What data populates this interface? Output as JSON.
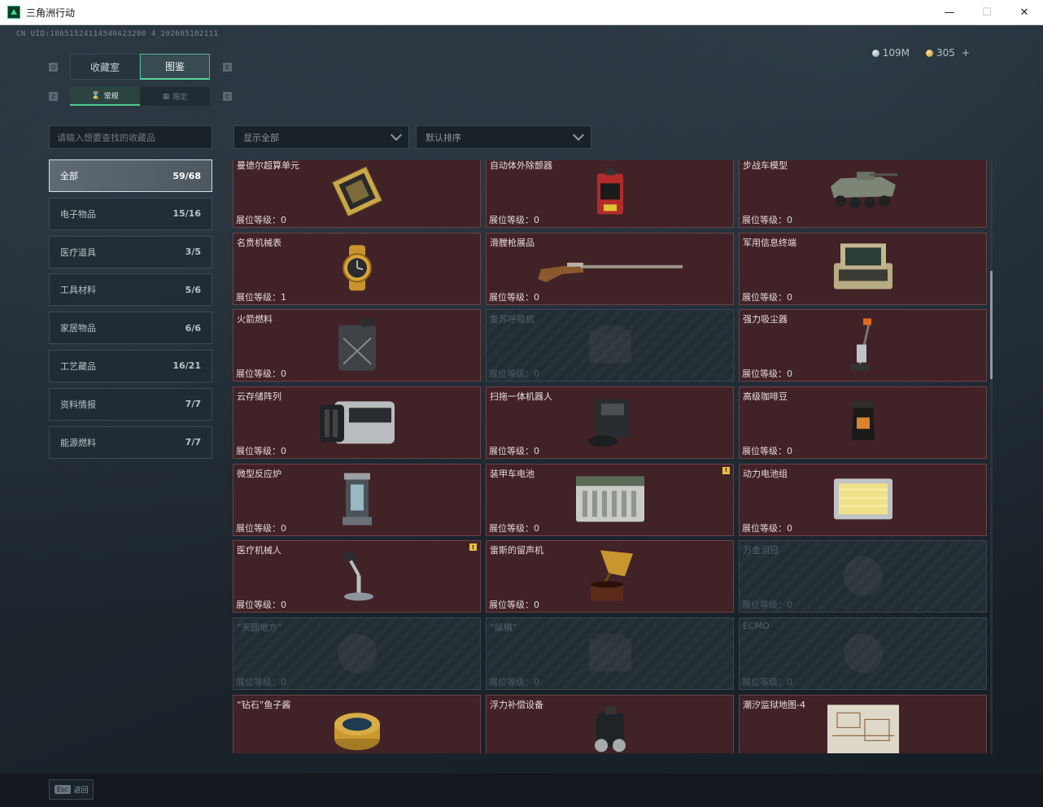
{
  "window": {
    "title": "三角洲行动",
    "minimize": "—",
    "maximize": "☐",
    "close": "✕"
  },
  "uid_text": "CN UID:18651524114540423200 4_202605102111",
  "currency": {
    "silver": "109M",
    "gold": "305",
    "plus": "+"
  },
  "main_tabs": [
    {
      "label": "收藏室"
    },
    {
      "label": "图鉴"
    }
  ],
  "sub_tabs": [
    {
      "label": "常规",
      "icon": "hourglass-icon"
    },
    {
      "label": "限定",
      "icon": "film-icon"
    }
  ],
  "key_hints": {
    "left": "Q",
    "right": "E",
    "sub_left": "Z",
    "sub_right": "C"
  },
  "search": {
    "placeholder": "请输入想要查找的收藏品"
  },
  "filters": {
    "show": "显示全部",
    "sort": "默认排序"
  },
  "categories": [
    {
      "label": "全部",
      "count": "59/68"
    },
    {
      "label": "电子物品",
      "count": "15/16"
    },
    {
      "label": "医疗道具",
      "count": "3/5"
    },
    {
      "label": "工具材料",
      "count": "5/6"
    },
    {
      "label": "家居物品",
      "count": "6/6"
    },
    {
      "label": "工艺藏品",
      "count": "16/21"
    },
    {
      "label": "资料情报",
      "count": "7/7"
    },
    {
      "label": "能源燃料",
      "count": "7/7"
    }
  ],
  "level_label": "展位等级：",
  "items": [
    {
      "name": "曼德尔超算单元",
      "level": "0",
      "locked": false,
      "art": "chip"
    },
    {
      "name": "自动体外除颤器",
      "level": "0",
      "locked": false,
      "art": "defib"
    },
    {
      "name": "步战车模型",
      "level": "0",
      "locked": false,
      "art": "ifv"
    },
    {
      "name": "名贵机械表",
      "level": "1",
      "locked": false,
      "art": "watch"
    },
    {
      "name": "滑膛枪展品",
      "level": "0",
      "locked": false,
      "art": "musket"
    },
    {
      "name": "军用信息终端",
      "level": "0",
      "locked": false,
      "art": "terminal"
    },
    {
      "name": "火箭燃料",
      "level": "0",
      "locked": false,
      "art": "jerrycan"
    },
    {
      "name": "复苏呼吸机",
      "level": "0",
      "locked": true,
      "art": "box"
    },
    {
      "name": "强力吸尘器",
      "level": "0",
      "locked": false,
      "art": "vacuum"
    },
    {
      "name": "云存储阵列",
      "level": "0",
      "locked": false,
      "art": "server"
    },
    {
      "name": "扫拖一体机器人",
      "level": "0",
      "locked": false,
      "art": "robot"
    },
    {
      "name": "高级咖啡豆",
      "level": "0",
      "locked": false,
      "art": "coffee"
    },
    {
      "name": "微型反应炉",
      "level": "0",
      "locked": false,
      "art": "reactor"
    },
    {
      "name": "装甲车电池",
      "level": "0",
      "locked": false,
      "art": "battery",
      "badge": "!"
    },
    {
      "name": "动力电池组",
      "level": "0",
      "locked": false,
      "art": "powercell"
    },
    {
      "name": "医疗机械人",
      "level": "0",
      "locked": false,
      "art": "medbot",
      "badge": "!"
    },
    {
      "name": "雷斯的留声机",
      "level": "0",
      "locked": false,
      "art": "gramophone"
    },
    {
      "name": "万金泪冠",
      "level": "0",
      "locked": true,
      "art": "orb"
    },
    {
      "name": "“天圆地方”",
      "level": "0",
      "locked": true,
      "art": "orb"
    },
    {
      "name": "“纵横”",
      "level": "0",
      "locked": true,
      "art": "box"
    },
    {
      "name": "ECMO",
      "level": "0",
      "locked": true,
      "art": "orb"
    },
    {
      "name": "“钻石”鱼子酱",
      "level": "",
      "locked": false,
      "art": "caviar"
    },
    {
      "name": "浮力补偿设备",
      "level": "",
      "locked": false,
      "art": "bcd"
    },
    {
      "name": "潮汐监狱地图-4",
      "level": "",
      "locked": false,
      "art": "map"
    }
  ],
  "bottom": {
    "esc_key": "Esc",
    "esc_label": "返回"
  }
}
